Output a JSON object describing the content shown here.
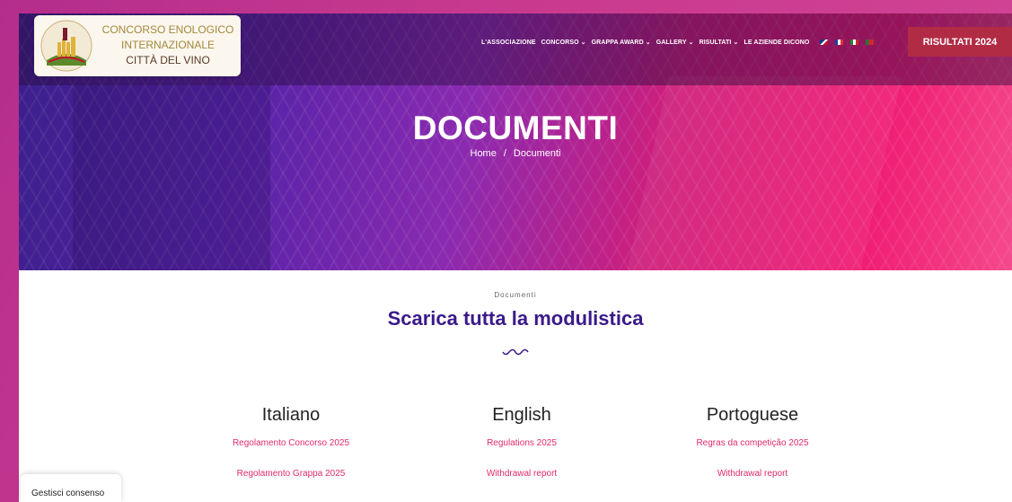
{
  "logo": {
    "line1": "CONCORSO ENOLOGICO",
    "line2": "INTERNAZIONALE",
    "line3": "CITTÀ DEL VINO",
    "seal_text": "INTERNATIONAL WINE CITY CHALLENGE"
  },
  "nav": {
    "items": [
      {
        "label": "L'ASSOCIAZIONE",
        "has_dropdown": false
      },
      {
        "label": "CONCORSO",
        "has_dropdown": true
      },
      {
        "label": "GRAPPA AWARD",
        "has_dropdown": true
      },
      {
        "label": "GALLERY",
        "has_dropdown": true
      },
      {
        "label": "RISULTATI",
        "has_dropdown": true
      },
      {
        "label": "LE AZIENDE DICONO",
        "has_dropdown": false
      }
    ],
    "flags": [
      "uk-flag-icon",
      "france-flag-icon",
      "italy-flag-icon",
      "portugal-flag-icon"
    ],
    "cta_label": "RISULTATI 2024"
  },
  "hero": {
    "title": "DOCUMENTI",
    "breadcrumb": {
      "home": "Home",
      "separator": "/",
      "current": "Documenti"
    }
  },
  "section": {
    "eyebrow": "Documenti",
    "title": "Scarica tutta la modulistica"
  },
  "columns": [
    {
      "heading": "Italiano",
      "links": [
        "Regolamento Concorso 2025",
        "Regolamento Grappa 2025"
      ]
    },
    {
      "heading": "English",
      "links": [
        "Regulations 2025",
        "Withdrawal report"
      ]
    },
    {
      "heading": "Portoguese",
      "links": [
        "Regras da competição 2025",
        "Withdrawal report"
      ]
    }
  ],
  "consent": {
    "label": "Gestisci consenso"
  },
  "colors": {
    "accent": "#e02a6c",
    "title": "#3a1a8a",
    "cta": "#b22b45"
  }
}
